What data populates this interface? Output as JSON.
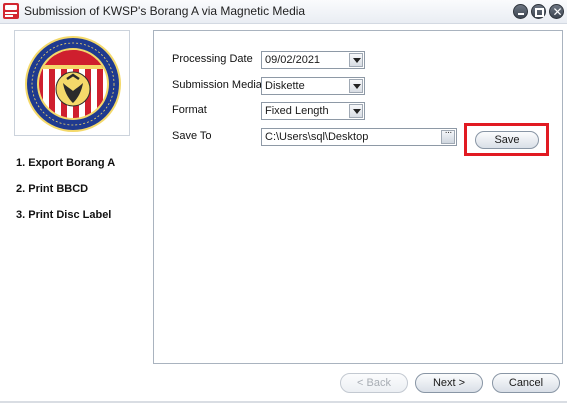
{
  "window": {
    "title": "Submission of KWSP's Borang A via Magnetic Media",
    "app_icon": "app-logo-icon",
    "controls": [
      "minimize-icon",
      "maximize-icon",
      "close-icon"
    ],
    "close_glyph": "✕"
  },
  "sidebar": {
    "logo": "kwsp-logo",
    "steps": [
      {
        "label": "1. Export Borang A"
      },
      {
        "label": "2. Print BBCD"
      },
      {
        "label": "3. Print Disc Label"
      }
    ]
  },
  "form": {
    "processing_date": {
      "label": "Processing Date",
      "value": "09/02/2021"
    },
    "submission_media": {
      "label": "Submission Media",
      "value": "Diskette"
    },
    "format": {
      "label": "Format",
      "value": "Fixed Length"
    },
    "save_to": {
      "label": "Save To",
      "value": "C:\\Users\\sql\\Desktop",
      "browse_label": "···"
    },
    "save_button": "Save",
    "highlight_color": "#e11a22"
  },
  "footer": {
    "back": "< Back",
    "next": "Next >",
    "cancel": "Cancel"
  }
}
